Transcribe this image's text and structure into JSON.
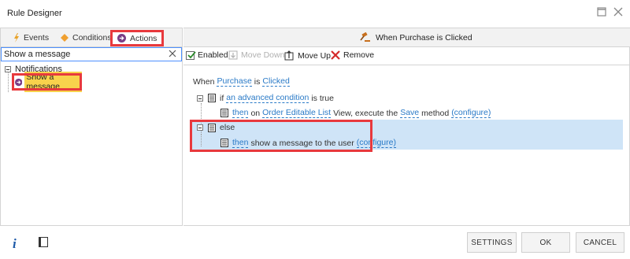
{
  "window": {
    "title": "Rule Designer"
  },
  "tabs": [
    {
      "label": "Events"
    },
    {
      "label": "Conditions"
    },
    {
      "label": "Actions"
    }
  ],
  "search": {
    "value": "Show a message",
    "placeholder": ""
  },
  "tree": {
    "category": "Notifications",
    "items": [
      {
        "label": "Show a message"
      }
    ]
  },
  "header": {
    "title": "When Purchase is Clicked"
  },
  "toolbar": {
    "enabled_label": "Enabled",
    "enabled_checked": true,
    "move_down_label": "Move Down",
    "move_up_label": "Move Up",
    "remove_label": "Remove"
  },
  "rules": {
    "when": {
      "prefix": "When",
      "subject": "Purchase",
      "verb": "is",
      "event": "Clicked"
    },
    "if": {
      "prefix": "if",
      "condition": "an advanced condition",
      "suffix": "is true"
    },
    "then1": {
      "then": "then",
      "on": "on",
      "target": "Order Editable List",
      "mid": "View, execute the",
      "method": "Save",
      "method_suffix": "method",
      "configure": "(configure)"
    },
    "else": {
      "label": "else"
    },
    "then2": {
      "then": "then",
      "text": "show a message to the user",
      "configure": "(configure)"
    }
  },
  "buttons": {
    "settings": "SETTINGS",
    "ok": "OK",
    "cancel": "CANCEL"
  },
  "icons": {
    "info": "i"
  },
  "colors": {
    "highlight_red": "#e8393d",
    "link_blue": "#2a7ac7",
    "selection_blue": "#cfe4f7",
    "tree_highlight": "#f8d24c"
  }
}
